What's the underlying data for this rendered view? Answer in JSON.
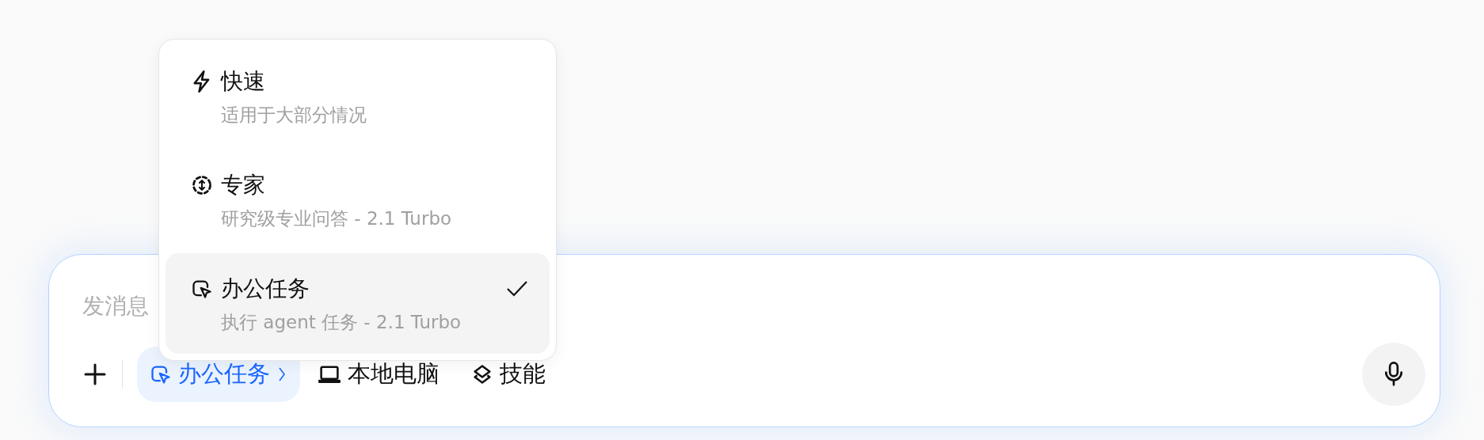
{
  "composer": {
    "placeholder": "发消息",
    "tools": [
      {
        "kind": "cursor",
        "label": "办公任务",
        "selected": true
      },
      {
        "kind": "laptop",
        "label": "本地电脑",
        "selected": false
      },
      {
        "kind": "layers",
        "label": "技能",
        "selected": false
      }
    ]
  },
  "mode_menu": {
    "items": [
      {
        "kind": "bolt",
        "title": "快速",
        "description": "适用于大部分情况",
        "selected": false
      },
      {
        "kind": "expert",
        "title": "专家",
        "description": "研究级专业问答 - 2.1 Turbo",
        "selected": false
      },
      {
        "kind": "cursor",
        "title": "办公任务",
        "description": "执行 agent 任务 - 2.1 Turbo",
        "selected": true
      }
    ]
  }
}
